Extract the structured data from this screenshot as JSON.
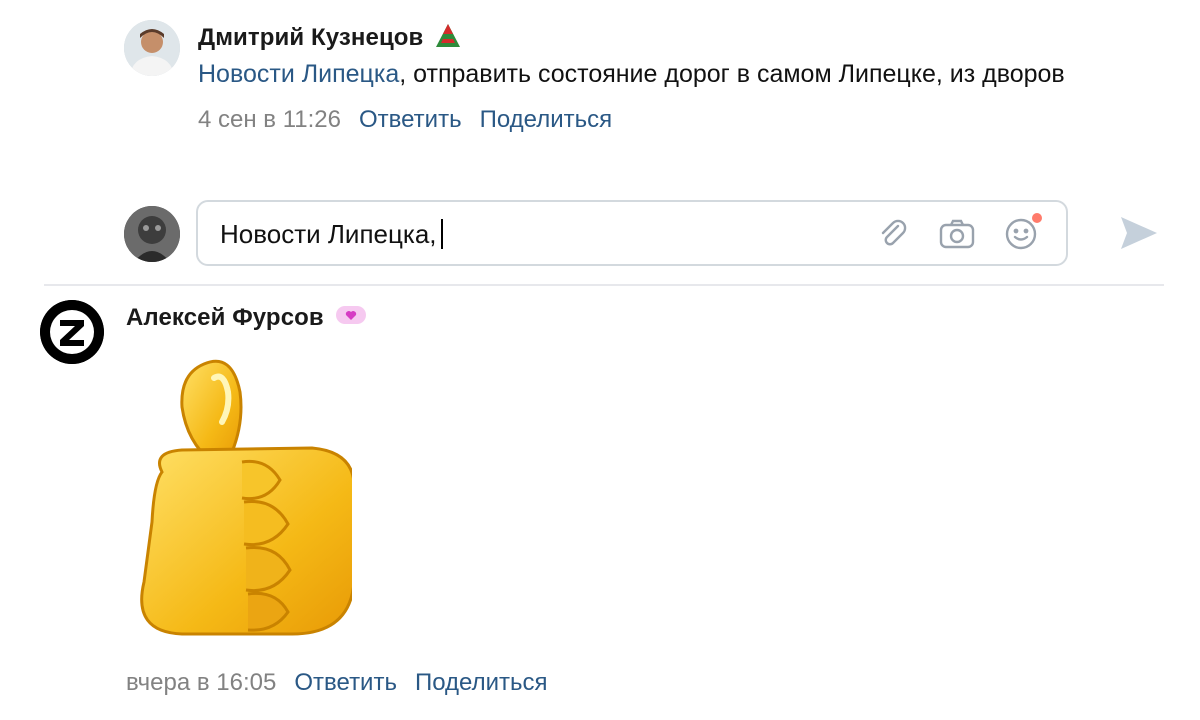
{
  "comment1": {
    "author": "Дмитрий Кузнецов",
    "mention": "Новости Липецка",
    "text": ", отправить состояние дорог в самом Липецке, из дворов",
    "time": "4 сен в 11:26",
    "reply": "Ответить",
    "share": "Поделиться",
    "badge_icon": "lokomotiv-emblem-icon"
  },
  "composer": {
    "value": "Новости Липецка,",
    "attach_icon": "paperclip-icon",
    "camera_icon": "camera-icon",
    "emoji_icon": "smile-icon",
    "send_icon": "send-arrow-icon"
  },
  "comment2": {
    "author": "Алексей Фурсов",
    "badge_icon": "pink-heart-bubble-icon",
    "sticker": "thumbs-up-sticker",
    "time": "вчера в 16:05",
    "reply": "Ответить",
    "share": "Поделиться"
  },
  "colors": {
    "link": "#2a5885",
    "meta": "#828282",
    "border": "#d3d9de",
    "thumb": "#f7c52a"
  }
}
